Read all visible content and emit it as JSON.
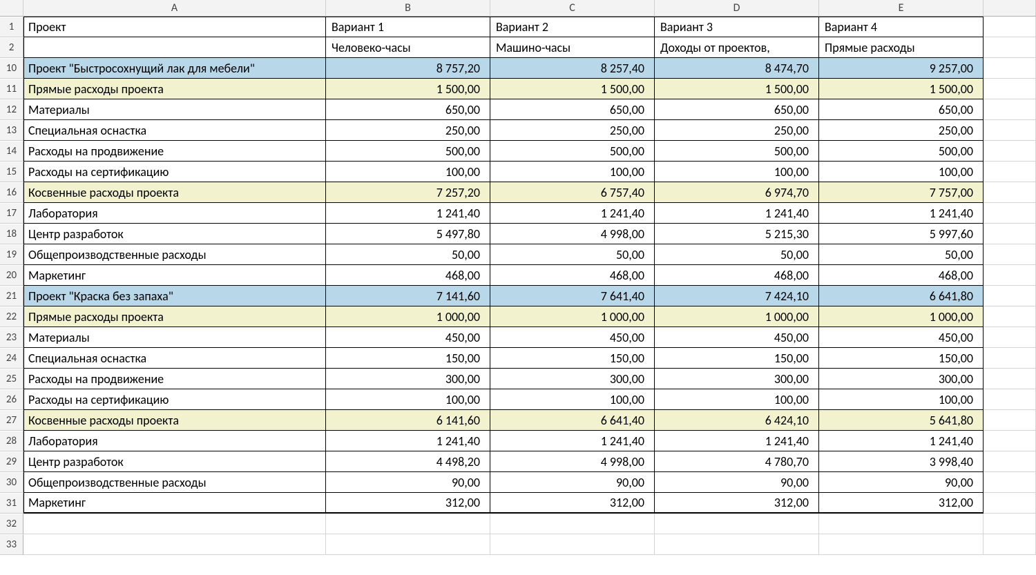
{
  "columns": {
    "A": "A",
    "B": "B",
    "C": "C",
    "D": "D",
    "E": "E"
  },
  "header1": {
    "A": "Проект",
    "B": "Вариант 1",
    "C": "Вариант 2",
    "D": "Вариант 3",
    "E": "Вариант 4"
  },
  "header2": {
    "A": "",
    "B": "Человеко-часы",
    "C": "Машино-часы",
    "D": "Доходы от проектов,",
    "E": "Прямые расходы"
  },
  "visible_row_numbers": [
    "1",
    "2",
    "10",
    "11",
    "12",
    "13",
    "14",
    "15",
    "16",
    "17",
    "18",
    "19",
    "20",
    "21",
    "22",
    "23",
    "24",
    "25",
    "26",
    "27",
    "28",
    "29",
    "30",
    "31",
    "32",
    "33"
  ],
  "rows": [
    {
      "n": "10",
      "fill": "blue",
      "A": "Проект \"Быстросохнущий лак для мебели\"",
      "B": "8 757,20",
      "C": "8 257,40",
      "D": "8 474,70",
      "E": "9 257,00"
    },
    {
      "n": "11",
      "fill": "cream",
      "A": "Прямые расходы проекта",
      "B": "1 500,00",
      "C": "1 500,00",
      "D": "1 500,00",
      "E": "1 500,00"
    },
    {
      "n": "12",
      "fill": "",
      "A": "Материалы",
      "B": "650,00",
      "C": "650,00",
      "D": "650,00",
      "E": "650,00"
    },
    {
      "n": "13",
      "fill": "",
      "A": "Специальная оснастка",
      "B": "250,00",
      "C": "250,00",
      "D": "250,00",
      "E": "250,00"
    },
    {
      "n": "14",
      "fill": "",
      "A": "Расходы на продвижение",
      "B": "500,00",
      "C": "500,00",
      "D": "500,00",
      "E": "500,00"
    },
    {
      "n": "15",
      "fill": "",
      "A": "Расходы на сертификацию",
      "B": "100,00",
      "C": "100,00",
      "D": "100,00",
      "E": "100,00"
    },
    {
      "n": "16",
      "fill": "cream",
      "A": "Косвенные расходы проекта",
      "B": "7 257,20",
      "C": "6 757,40",
      "D": "6 974,70",
      "E": "7 757,00"
    },
    {
      "n": "17",
      "fill": "",
      "A": "Лаборатория",
      "B": "1 241,40",
      "C": "1 241,40",
      "D": "1 241,40",
      "E": "1 241,40"
    },
    {
      "n": "18",
      "fill": "",
      "A": "Центр разработок",
      "B": "5 497,80",
      "C": "4 998,00",
      "D": "5 215,30",
      "E": "5 997,60"
    },
    {
      "n": "19",
      "fill": "",
      "A": "Общепроизводственные расходы",
      "B": "50,00",
      "C": "50,00",
      "D": "50,00",
      "E": "50,00"
    },
    {
      "n": "20",
      "fill": "",
      "A": "Маркетинг",
      "B": "468,00",
      "C": "468,00",
      "D": "468,00",
      "E": "468,00"
    },
    {
      "n": "21",
      "fill": "blue",
      "A": "Проект \"Краска без запаха\"",
      "B": "7 141,60",
      "C": "7 641,40",
      "D": "7 424,10",
      "E": "6 641,80"
    },
    {
      "n": "22",
      "fill": "cream",
      "A": "Прямые расходы проекта",
      "B": "1 000,00",
      "C": "1 000,00",
      "D": "1 000,00",
      "E": "1 000,00"
    },
    {
      "n": "23",
      "fill": "",
      "A": "Материалы",
      "B": "450,00",
      "C": "450,00",
      "D": "450,00",
      "E": "450,00"
    },
    {
      "n": "24",
      "fill": "",
      "A": "Специальная оснастка",
      "B": "150,00",
      "C": "150,00",
      "D": "150,00",
      "E": "150,00"
    },
    {
      "n": "25",
      "fill": "",
      "A": "Расходы на продвижение",
      "B": "300,00",
      "C": "300,00",
      "D": "300,00",
      "E": "300,00"
    },
    {
      "n": "26",
      "fill": "",
      "A": "Расходы на сертификацию",
      "B": "100,00",
      "C": "100,00",
      "D": "100,00",
      "E": "100,00"
    },
    {
      "n": "27",
      "fill": "cream",
      "A": "Косвенные расходы проекта",
      "B": "6 141,60",
      "C": "6 641,40",
      "D": "6 424,10",
      "E": "5 641,80"
    },
    {
      "n": "28",
      "fill": "",
      "A": "Лаборатория",
      "B": "1 241,40",
      "C": "1 241,40",
      "D": "1 241,40",
      "E": "1 241,40"
    },
    {
      "n": "29",
      "fill": "",
      "A": "Центр разработок",
      "B": "4 498,20",
      "C": "4 998,00",
      "D": "4 780,70",
      "E": "3 998,40"
    },
    {
      "n": "30",
      "fill": "",
      "A": "Общепроизводственные расходы",
      "B": "90,00",
      "C": "90,00",
      "D": "90,00",
      "E": "90,00"
    },
    {
      "n": "31",
      "fill": "",
      "A": "Маркетинг",
      "B": "312,00",
      "C": "312,00",
      "D": "312,00",
      "E": "312,00"
    }
  ],
  "chart_data": {
    "type": "table",
    "title": "Проект — сравнение вариантов",
    "columns": [
      "Вариант 1 (Человеко-часы)",
      "Вариант 2 (Машино-часы)",
      "Вариант 3 (Доходы от проектов)",
      "Вариант 4 (Прямые расходы)"
    ],
    "rows": [
      {
        "label": "Проект \"Быстросохнущий лак для мебели\"",
        "values": [
          8757.2,
          8257.4,
          8474.7,
          9257.0
        ]
      },
      {
        "label": "Прямые расходы проекта",
        "values": [
          1500.0,
          1500.0,
          1500.0,
          1500.0
        ]
      },
      {
        "label": "Материалы",
        "values": [
          650.0,
          650.0,
          650.0,
          650.0
        ]
      },
      {
        "label": "Специальная оснастка",
        "values": [
          250.0,
          250.0,
          250.0,
          250.0
        ]
      },
      {
        "label": "Расходы на продвижение",
        "values": [
          500.0,
          500.0,
          500.0,
          500.0
        ]
      },
      {
        "label": "Расходы на сертификацию",
        "values": [
          100.0,
          100.0,
          100.0,
          100.0
        ]
      },
      {
        "label": "Косвенные расходы проекта",
        "values": [
          7257.2,
          6757.4,
          6974.7,
          7757.0
        ]
      },
      {
        "label": "Лаборатория",
        "values": [
          1241.4,
          1241.4,
          1241.4,
          1241.4
        ]
      },
      {
        "label": "Центр разработок",
        "values": [
          5497.8,
          4998.0,
          5215.3,
          5997.6
        ]
      },
      {
        "label": "Общепроизводственные расходы",
        "values": [
          50.0,
          50.0,
          50.0,
          50.0
        ]
      },
      {
        "label": "Маркетинг",
        "values": [
          468.0,
          468.0,
          468.0,
          468.0
        ]
      },
      {
        "label": "Проект \"Краска без запаха\"",
        "values": [
          7141.6,
          7641.4,
          7424.1,
          6641.8
        ]
      },
      {
        "label": "Прямые расходы проекта",
        "values": [
          1000.0,
          1000.0,
          1000.0,
          1000.0
        ]
      },
      {
        "label": "Материалы",
        "values": [
          450.0,
          450.0,
          450.0,
          450.0
        ]
      },
      {
        "label": "Специальная оснастка",
        "values": [
          150.0,
          150.0,
          150.0,
          150.0
        ]
      },
      {
        "label": "Расходы на продвижение",
        "values": [
          300.0,
          300.0,
          300.0,
          300.0
        ]
      },
      {
        "label": "Расходы на сертификацию",
        "values": [
          100.0,
          100.0,
          100.0,
          100.0
        ]
      },
      {
        "label": "Косвенные расходы проекта",
        "values": [
          6141.6,
          6641.4,
          6424.1,
          5641.8
        ]
      },
      {
        "label": "Лаборатория",
        "values": [
          1241.4,
          1241.4,
          1241.4,
          1241.4
        ]
      },
      {
        "label": "Центр разработок",
        "values": [
          4498.2,
          4998.0,
          4780.7,
          3998.4
        ]
      },
      {
        "label": "Общепроизводственные расходы",
        "values": [
          90.0,
          90.0,
          90.0,
          90.0
        ]
      },
      {
        "label": "Маркетинг",
        "values": [
          312.0,
          312.0,
          312.0,
          312.0
        ]
      }
    ]
  }
}
